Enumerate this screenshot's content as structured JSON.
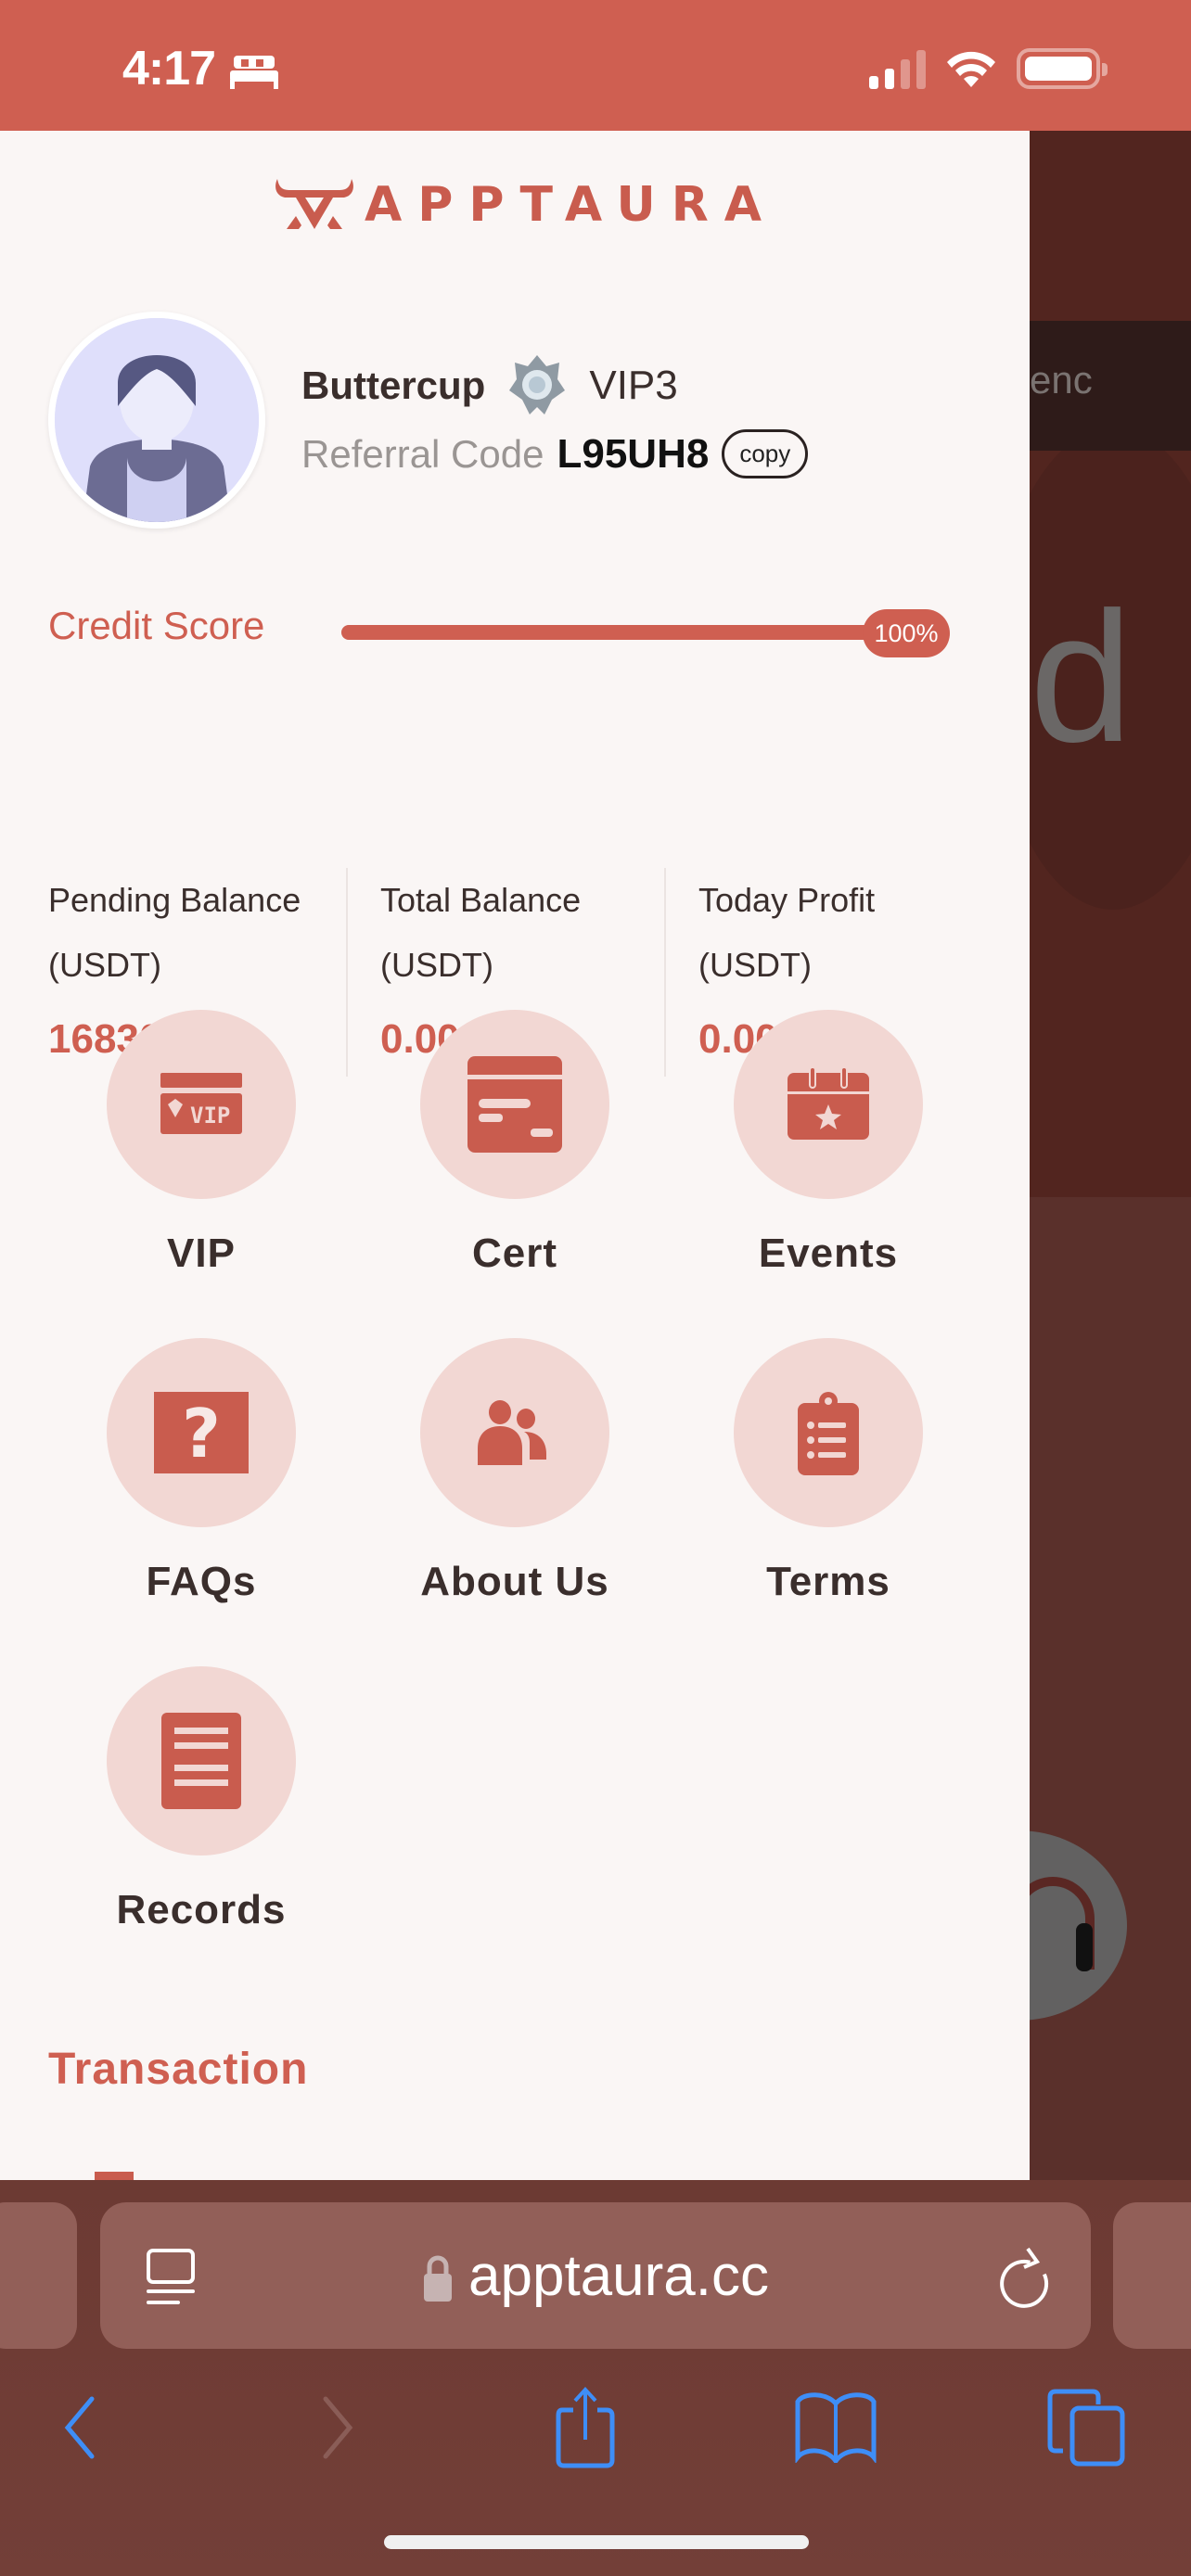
{
  "status_bar": {
    "time": "4:17",
    "focus_icon": "bed-icon",
    "signal_bars_active": 2,
    "signal_bars_total": 4
  },
  "background_page": {
    "band_text": "enc",
    "big_glyph": "d"
  },
  "drawer": {
    "brand": "APPTAURA",
    "profile": {
      "name": "Buttercup",
      "vip_level": "VIP3",
      "referral_label": "Referral Code",
      "referral_code": "L95UH8",
      "copy_label": "copy"
    },
    "credit": {
      "label": "Credit Score",
      "percent": 100,
      "percent_label": "100%"
    },
    "balances": [
      {
        "label_line1": "Pending Balance",
        "label_line2": "(USDT)",
        "value": "16830.35"
      },
      {
        "label_line1": "Total Balance",
        "label_line2": "(USDT)",
        "value": "0.00"
      },
      {
        "label_line1": "Today Profit",
        "label_line2": "(USDT)",
        "value": "0.00"
      }
    ],
    "menu": [
      {
        "label": "VIP",
        "icon": "vip-card-icon"
      },
      {
        "label": "Cert",
        "icon": "certificate-icon"
      },
      {
        "label": "Events",
        "icon": "calendar-star-icon"
      },
      {
        "label": "FAQs",
        "icon": "question-icon"
      },
      {
        "label": "About Us",
        "icon": "users-icon"
      },
      {
        "label": "Terms",
        "icon": "clipboard-list-icon"
      },
      {
        "label": "Records",
        "icon": "records-icon"
      }
    ],
    "section_title": "Transaction"
  },
  "browser": {
    "url": "apptaura.cc",
    "back_enabled": true,
    "forward_enabled": false
  },
  "colors": {
    "brand": "#cf5f51",
    "icon_bg": "#f2d7d3",
    "ios_blue": "#3e8ef7"
  }
}
